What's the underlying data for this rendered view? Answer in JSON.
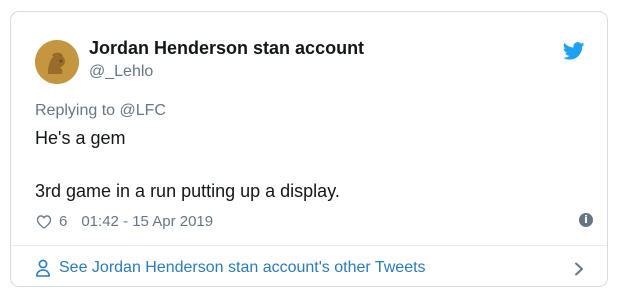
{
  "tweet": {
    "author_name": "Jordan Henderson stan account",
    "author_handle": "@_Lehlo",
    "replying_label": "Replying to ",
    "replying_to": "@LFC",
    "text_line1": "He's a gem",
    "text_line2": "3rd game in a run putting up a display.",
    "likes": "6",
    "timestamp": "01:42 - 15 Apr 2019",
    "footer_link": "See Jordan Henderson stan account's other Tweets"
  },
  "icons": {
    "brand": "twitter-bird-icon",
    "like": "heart-icon",
    "info": "info-icon",
    "profile": "person-icon",
    "more": "chevron-right-icon"
  },
  "colors": {
    "twitter_blue": "#1da1f2",
    "link_blue": "#2b7bb9",
    "muted": "#657786",
    "text": "#14171a",
    "border": "#d5dde3"
  }
}
